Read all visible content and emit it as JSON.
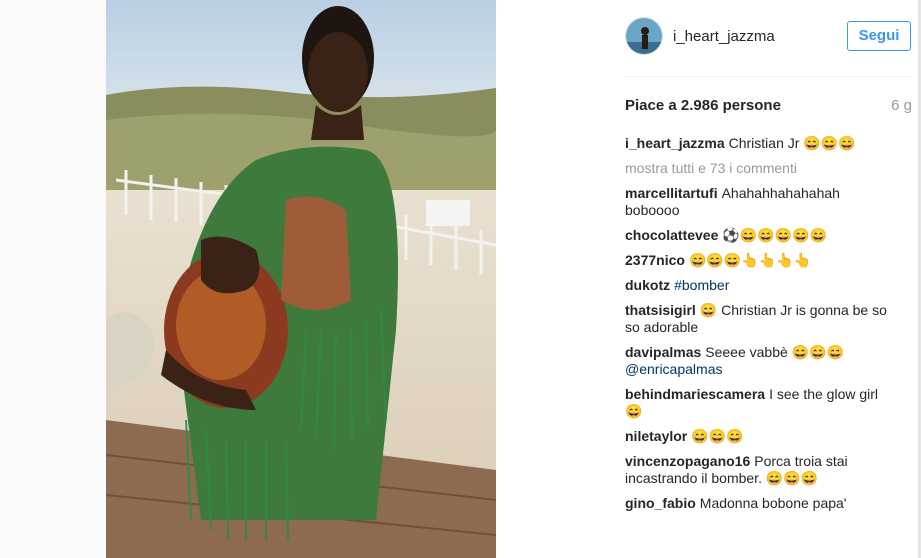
{
  "post": {
    "username": "i_heart_jazzma",
    "follow_label": "Segui",
    "likes_text": "Piace a 2.986 persone",
    "time_ago": "6 g",
    "caption": {
      "user": "i_heart_jazzma",
      "text": "Christian Jr 😄😄😄"
    },
    "view_all": "mostra tutti e 73 i commenti",
    "comments": [
      {
        "user": "marcellitartufi",
        "text": "Ahahahhahahahah boboooo"
      },
      {
        "user": "chocolattevee",
        "text": "⚽😄😄😄😄😄"
      },
      {
        "user": "2377nico",
        "text": "😄😄😄👆👆👆👆"
      },
      {
        "user": "dukotz",
        "text": "",
        "link": "#bomber"
      },
      {
        "user": "thatsisigirl",
        "text": "😄 Christian Jr is gonna be so so adorable"
      },
      {
        "user": "davipalmas",
        "text": "Seeee vabbè 😄😄😄",
        "link": "@enricapalmas"
      },
      {
        "user": "behindmariescamera",
        "text": "I see the glow girl 😄"
      },
      {
        "user": "niletaylor",
        "text": "😄😄😄"
      },
      {
        "user": "vincenzopagano16",
        "text": "Porca troia stai incastrando il bomber. 😄😄😄"
      },
      {
        "user": "gino_fabio",
        "text": "Madonna bobone papa'"
      }
    ]
  },
  "colors": {
    "accent": "#3897f0",
    "link": "#003569",
    "muted": "#999999"
  },
  "icons": {
    "avatar": "profile-avatar"
  }
}
